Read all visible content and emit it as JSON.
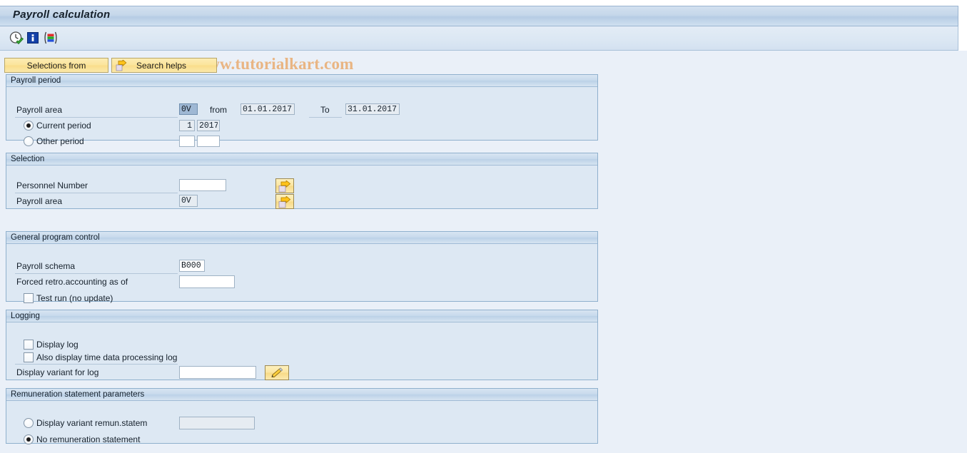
{
  "window": {
    "title": "Payroll calculation"
  },
  "toolbar": {
    "icons": [
      {
        "name": "execute-clock-icon",
        "label": "Execute"
      },
      {
        "name": "information-icon",
        "label": "Information"
      },
      {
        "name": "variant-bars-icon",
        "label": "Get Variant"
      }
    ],
    "watermark": "© www.tutorialkart.com"
  },
  "tabs": [
    {
      "id": "selections-from",
      "label": "Selections from"
    },
    {
      "id": "search-helps",
      "label": "Search helps",
      "icon": "arrow-right-icon"
    }
  ],
  "sections": {
    "payroll_period": {
      "header": "Payroll period",
      "payroll_area_label": "Payroll area",
      "payroll_area_value": "0V",
      "from_label": "from",
      "from_value": "01.01.2017",
      "to_label": "To",
      "to_value": "31.01.2017",
      "current_period_label": "Current period",
      "current_period_selected": true,
      "current_period_num": "1",
      "current_period_year": "2017",
      "other_period_label": "Other period",
      "other_period_selected": false,
      "other_period_num": "",
      "other_period_year": ""
    },
    "selection": {
      "header": "Selection",
      "personnel_number_label": "Personnel Number",
      "personnel_number_value": "",
      "personnel_number_help": "multi-selection-icon",
      "payroll_area_label": "Payroll area",
      "payroll_area_value": "0V",
      "payroll_area_help": "multi-selection-icon"
    },
    "general_program_control": {
      "header": "General program control",
      "payroll_schema_label": "Payroll schema",
      "payroll_schema_value": "B000",
      "forced_retro_label": "Forced retro.accounting as of",
      "forced_retro_value": "",
      "test_run_label": "Test run (no update)",
      "test_run_checked": false
    },
    "logging": {
      "header": "Logging",
      "display_log_label": "Display log",
      "display_log_checked": false,
      "time_data_log_label": "Also display time data processing log",
      "time_data_log_checked": false,
      "display_variant_label": "Display variant for log",
      "display_variant_value": "",
      "display_variant_edit_icon": "pencil-icon"
    },
    "remuneration": {
      "header": "Remuneration statement parameters",
      "display_variant_label": "Display variant remun.statem",
      "display_variant_selected": false,
      "display_variant_value": "",
      "no_statement_label": "No remuneration statement",
      "no_statement_selected": true
    }
  },
  "colors": {
    "title_bar": "#c5d7ea",
    "panel_bg": "#dde8f3",
    "panel_border": "#8fb0cd",
    "tab_yellow": "#fbe49a",
    "watermark": "#e9b583",
    "page_bg": "#eaf0f8",
    "selected_field": "#9fb8d4"
  }
}
